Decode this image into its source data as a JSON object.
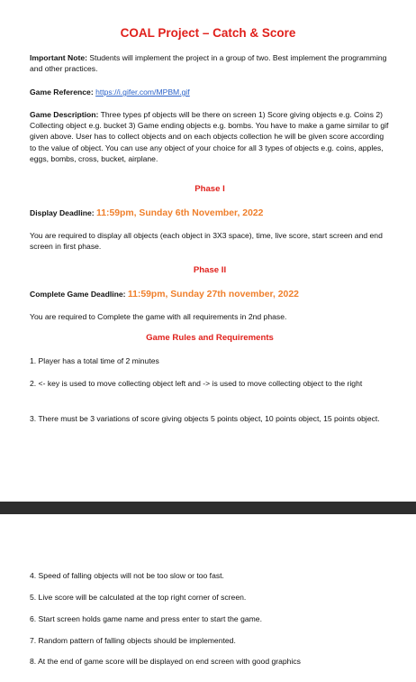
{
  "title": "COAL Project – Catch & Score",
  "note": {
    "label": "Important Note:",
    "text": " Students will implement the project in a group of two. Best implement the programming and other practices."
  },
  "reference": {
    "label": "Game Reference:",
    "url": "https://i.gifer.com/MPBM.gif"
  },
  "description": {
    "label": "Game Description:",
    "text": " Three types pf objects will be there on screen 1) Score giving objects e.g. Coins 2) Collecting object e.g. bucket 3) Game ending objects e.g. bombs. You have to make a game similar to gif given above. User has to collect objects and on each objects collection he will be given score according to the value of object. You can use any object of your choice for all 3 types of objects e.g. coins, apples, eggs, bombs, cross, bucket, airplane."
  },
  "phase1": {
    "heading": "Phase I",
    "deadline_label": "Display Deadline:",
    "deadline_value": "11:59pm, Sunday 6th November, 2022",
    "text": "You are required to display all objects (each object in 3X3 space), time, live score, start screen and end screen in first phase."
  },
  "phase2": {
    "heading": "Phase II",
    "deadline_label": "Complete Game Deadline:",
    "deadline_value": "11:59pm, Sunday 27th november, 2022",
    "text": "You are required to Complete the game with all requirements in 2nd phase."
  },
  "rules": {
    "heading": "Game Rules and Requirements",
    "items": [
      "1. Player has a total time of 2 minutes",
      "2. <- key is used to move collecting object left and -> is used to move collecting object to the right",
      "3. There must be 3 variations of score giving objects 5 points object, 10 points object, 15 points object.",
      "4. Speed of falling objects will not be too slow or too fast.",
      "5. Live score will be calculated at the top right corner of screen.",
      "6. Start screen holds game name and press enter to start the game.",
      "7. Random pattern of falling objects should be implemented.",
      "8. At the end of game score will be displayed on end screen with good graphics"
    ]
  }
}
